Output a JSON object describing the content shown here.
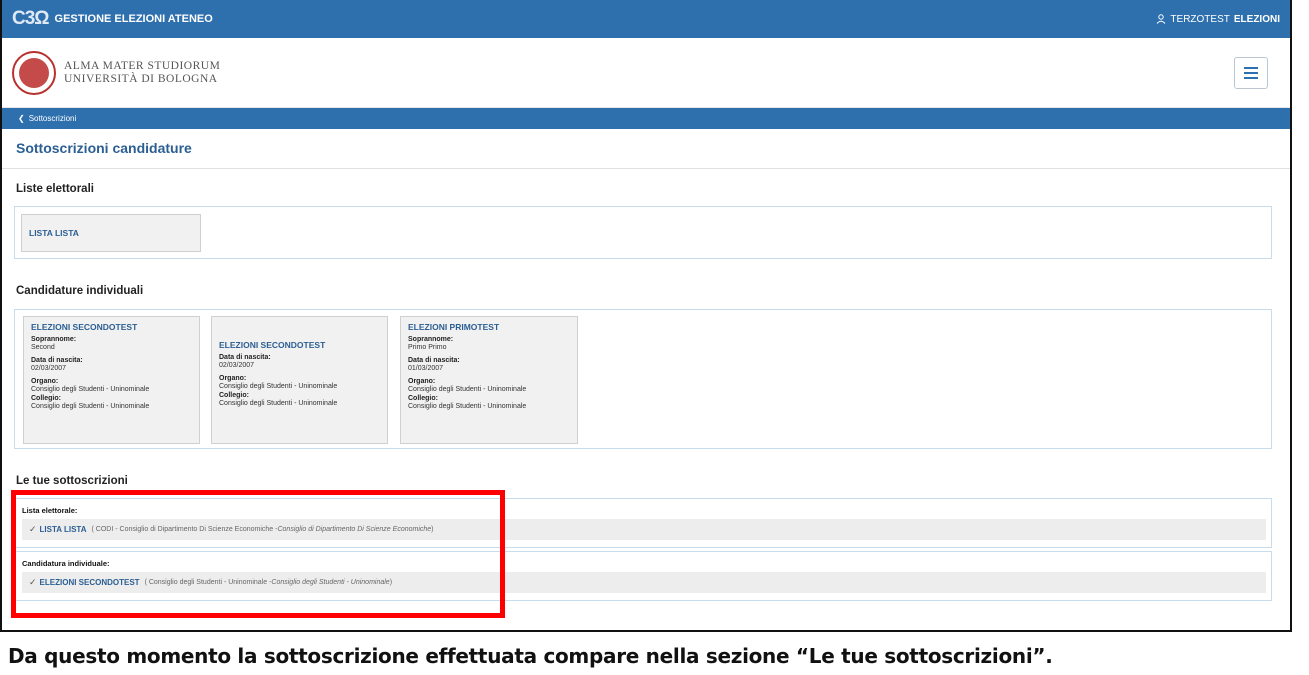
{
  "topbar": {
    "logo": "C3Ω",
    "app_title": "GESTIONE ELEZIONI ATENEO",
    "user_prefix": "TERZOTEST",
    "user_suffix": "ELEZIONI",
    "color": "#2e6fae"
  },
  "brand": {
    "line1": "ALMA MATER STUDIORUM",
    "line2": "UNIVERSITÀ DI BOLOGNA"
  },
  "breadcrumb": {
    "back_label": "Sottoscrizioni"
  },
  "page": {
    "title": "Sottoscrizioni candidature"
  },
  "liste": {
    "title": "Liste elettorali",
    "items": [
      {
        "name": "LISTA LISTA"
      }
    ]
  },
  "candidature": {
    "title": "Candidature individuali",
    "labels": {
      "soprannome": "Soprannome:",
      "nascita": "Data di nascita:",
      "organo": "Organo:",
      "collegio": "Collegio:"
    },
    "cards": [
      {
        "name": "ELEZIONI SECONDOTEST",
        "soprannome": "Second",
        "nascita": "02/03/2007",
        "organo": "Consiglio degli Studenti - Uninominale",
        "collegio": "Consiglio degli Studenti - Uninominale"
      },
      {
        "name": "ELEZIONI SECONDOTEST",
        "nascita": "02/03/2007",
        "organo": "Consiglio degli Studenti - Uninominale",
        "collegio": "Consiglio degli Studenti - Uninominale"
      },
      {
        "name": "ELEZIONI PRIMOTEST",
        "soprannome": "Primo Primo",
        "nascita": "01/03/2007",
        "organo": "Consiglio degli Studenti - Uninominale",
        "collegio": "Consiglio degli Studenti - Uninominale"
      }
    ]
  },
  "tue": {
    "title": "Le tue sottoscrizioni",
    "lista": {
      "head": "Lista elettorale:",
      "name": "LISTA LISTA",
      "detail_open": "( CODI - Consiglio di Dipartimento Di Scienze Economiche - ",
      "detail_italic": "Consiglio di Dipartimento Di Scienze Economiche",
      "detail_close": " )"
    },
    "candidatura": {
      "head": "Candidatura individuale:",
      "name": "ELEZIONI SECONDOTEST",
      "detail_open": "( Consiglio degli Studenti - Uninominale - ",
      "detail_italic": "Consiglio degli Studenti - Uninominale",
      "detail_close": " )"
    }
  },
  "caption": "Da questo momento la sottoscrizione effettuata compare nella sezione “Le tue sottoscrizioni”.",
  "colors": {
    "accent": "#2e6fae",
    "highlight": "#ff0000"
  }
}
